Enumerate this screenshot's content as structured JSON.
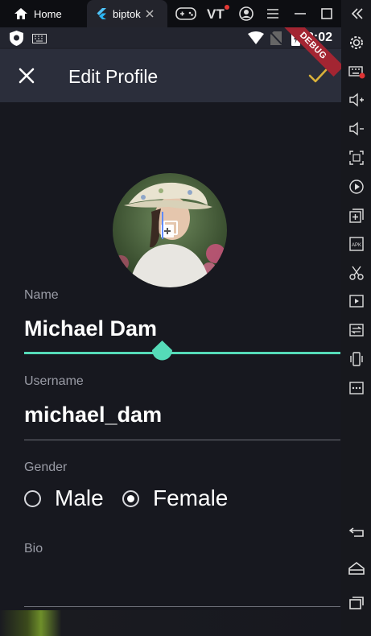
{
  "browser_tabs": {
    "home_label": "Home",
    "app_label": "biptok"
  },
  "toolbar_icons": [
    "gamepad-icon",
    "vt-icon",
    "account-icon",
    "menu-icon",
    "minimize-icon",
    "maximize-icon",
    "close-icon"
  ],
  "toolbar": {
    "vt_label": "VT"
  },
  "status_bar": {
    "time": "3:02"
  },
  "app_bar": {
    "title": "Edit Profile"
  },
  "debug_banner": "DEBUG",
  "form": {
    "name_label": "Name",
    "name_value": "Michael Dam",
    "username_label": "Username",
    "username_value": "michael_dam",
    "gender_label": "Gender",
    "gender_options": [
      "Male",
      "Female"
    ],
    "gender_selected": "Female",
    "bio_label": "Bio",
    "bio_value": ""
  },
  "sidebar_icons": [
    "settings-icon",
    "keyboard-icon",
    "volume-up-icon",
    "volume-down-icon",
    "screenshot-icon",
    "record-icon",
    "add-window-icon",
    "apk-icon",
    "scissors-icon",
    "video-icon",
    "sync-icon",
    "shake-icon",
    "more-icon",
    "back-icon",
    "home-icon",
    "recents-icon"
  ],
  "colors": {
    "accent": "#55dbb8",
    "check": "#d9b13a",
    "appbar": "#2b2e3b",
    "background": "#17181f"
  }
}
